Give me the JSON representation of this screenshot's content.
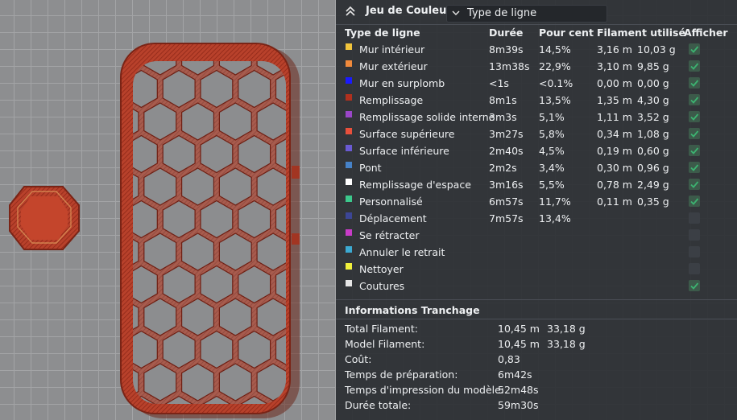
{
  "panel": {
    "title": "Jeu de Couleur",
    "view_type": "Type de ligne"
  },
  "table": {
    "columns": [
      "Type de ligne",
      "Durée",
      "Pour cent",
      "Filament utilisé",
      "Afficher"
    ],
    "rows": [
      {
        "name": "Mur intérieur",
        "color": "#f0c43c",
        "duration": "8m39s",
        "percent": "14,5%",
        "length": "3,16 m",
        "weight": "10,03 g",
        "shown": true
      },
      {
        "name": "Mur extérieur",
        "color": "#f08a3c",
        "duration": "13m38s",
        "percent": "22,9%",
        "length": "3,10 m",
        "weight": "9,85 g",
        "shown": true
      },
      {
        "name": "Mur en surplomb",
        "color": "#1a1aff",
        "duration": "<1s",
        "percent": "<0.1%",
        "length": "0,00 m",
        "weight": "0,00 g",
        "shown": true
      },
      {
        "name": "Remplissage",
        "color": "#b0301e",
        "duration": "8m1s",
        "percent": "13,5%",
        "length": "1,35 m",
        "weight": "4,30 g",
        "shown": true
      },
      {
        "name": "Remplissage solide interne",
        "color": "#9a46c8",
        "duration": "3m3s",
        "percent": "5,1%",
        "length": "1,11 m",
        "weight": "3,52 g",
        "shown": true
      },
      {
        "name": "Surface supérieure",
        "color": "#e8503c",
        "duration": "3m27s",
        "percent": "5,8%",
        "length": "0,34 m",
        "weight": "1,08 g",
        "shown": true
      },
      {
        "name": "Surface inférieure",
        "color": "#6a5ad2",
        "duration": "2m40s",
        "percent": "4,5%",
        "length": "0,19 m",
        "weight": "0,60 g",
        "shown": true
      },
      {
        "name": "Pont",
        "color": "#4682c8",
        "duration": "2m2s",
        "percent": "3,4%",
        "length": "0,30 m",
        "weight": "0,96 g",
        "shown": true
      },
      {
        "name": "Remplissage d'espace",
        "color": "#ffffff",
        "duration": "3m16s",
        "percent": "5,5%",
        "length": "0,78 m",
        "weight": "2,49 g",
        "shown": true
      },
      {
        "name": "Personnalisé",
        "color": "#3cc88c",
        "duration": "6m57s",
        "percent": "11,7%",
        "length": "0,11 m",
        "weight": "0,35 g",
        "shown": true
      },
      {
        "name": "Déplacement",
        "color": "#3c4696",
        "duration": "7m57s",
        "percent": "13,4%",
        "length": "",
        "weight": "",
        "shown": false
      },
      {
        "name": "Se rétracter",
        "color": "#c83cc8",
        "duration": "",
        "percent": "",
        "length": "",
        "weight": "",
        "shown": false
      },
      {
        "name": "Annuler le retrait",
        "color": "#3caad2",
        "duration": "",
        "percent": "",
        "length": "",
        "weight": "",
        "shown": false
      },
      {
        "name": "Nettoyer",
        "color": "#f0f03c",
        "duration": "",
        "percent": "",
        "length": "",
        "weight": "",
        "shown": false
      },
      {
        "name": "Coutures",
        "color": "#e6e6e6",
        "duration": "",
        "percent": "",
        "length": "",
        "weight": "",
        "shown": true
      }
    ]
  },
  "slicing": {
    "title": "Informations Tranchage",
    "rows": [
      {
        "label": "Total Filament:",
        "value": "10,45 m",
        "value2": "33,18 g"
      },
      {
        "label": "Model Filament:",
        "value": "10,45 m",
        "value2": "33,18 g"
      },
      {
        "label": "Coût:",
        "value": "0,83",
        "value2": ""
      },
      {
        "label": "Temps de préparation:",
        "value": "6m42s",
        "value2": ""
      },
      {
        "label": "Temps d'impression du modèle:",
        "value": "52m48s",
        "value2": ""
      },
      {
        "label": "Durée totale:",
        "value": "59m30s",
        "value2": ""
      }
    ]
  },
  "colors": {
    "model_red": "#b33a26",
    "check_green": "#3cb371"
  }
}
